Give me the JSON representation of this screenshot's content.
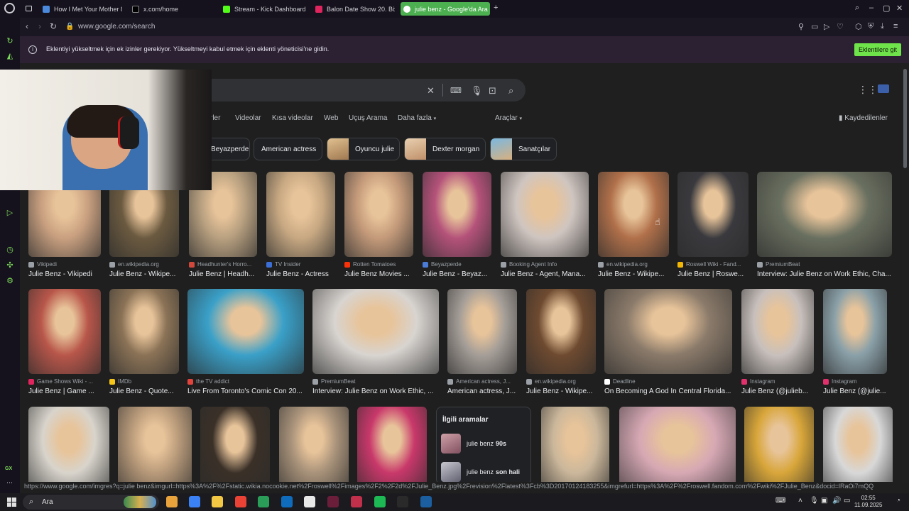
{
  "browser": {
    "tabs": [
      {
        "label": "How I Met Your Mother 8.",
        "color": "#4a89dc"
      },
      {
        "label": "x.com/home",
        "color": "#000000"
      },
      {
        "label": "Stream - Kick Dashboard",
        "color": "#53fc18"
      },
      {
        "label": "Balon Date Show 20. Böl",
        "color": "#e0245e"
      },
      {
        "label": "julie benz - Google'da Ara",
        "color": "#ffffff"
      }
    ],
    "new_tab": "+",
    "url": "www.google.com/search"
  },
  "notification": {
    "message": "Eklentiyi yükseltmek için ek izinler gerekiyor. Yükseltmeyi kabul etmek için eklenti yöneticisi'ne gidin.",
    "button": "Eklentilere git"
  },
  "search": {
    "filters": [
      "rler",
      "Videolar",
      "Kısa videolar",
      "Web",
      "Uçuş Arama",
      "Daha fazla",
      "Araçlar"
    ],
    "saved": "Kaydedilenler",
    "chips": [
      "Beyazperde",
      "American actress",
      "Oyuncu julie",
      "Dexter morgan",
      "Sanatçılar"
    ]
  },
  "row1": [
    {
      "source": "Vikipedi",
      "title": "Julie Benz - Vikipedi",
      "fav": "#9aa0a6",
      "c": "#c9a080"
    },
    {
      "source": "en.wikipedia.org",
      "title": "Julie Benz - Wikipe...",
      "fav": "#9aa0a6",
      "c": "#6b5a40"
    },
    {
      "source": "Headhunter's Horro...",
      "title": "Julie Benz | Headh...",
      "fav": "#d0483c",
      "c": "#b8a080"
    },
    {
      "source": "TV Insider",
      "title": "Julie Benz - Actress",
      "fav": "#3b6fd6",
      "c": "#c7a882"
    },
    {
      "source": "Rotten Tomatoes",
      "title": "Julie Benz Movies ...",
      "fav": "#fa320a",
      "c": "#c49a7a"
    },
    {
      "source": "Beyazperde",
      "title": "Julie Benz - Beyaz...",
      "fav": "#4a7bd6",
      "c": "#b4527a"
    },
    {
      "source": "Booking Agent Info",
      "title": "Julie Benz - Agent, Mana...",
      "fav": "#9aa0a6",
      "c": "#cfc5c0"
    },
    {
      "source": "en.wikipedia.org",
      "title": "Julie Benz - Wikipe...",
      "fav": "#9aa0a6",
      "c": "#b0704a"
    },
    {
      "source": "Roswell Wiki - Fand...",
      "title": "Julie Benz | Roswe...",
      "fav": "#f2b705",
      "c": "#3a3a3e"
    },
    {
      "source": "PremiumBeat",
      "title": "Interview: Julie Benz on Work Ethic, Cha...",
      "fav": "#9aa0a6",
      "c": "#6a7060"
    }
  ],
  "row2": [
    {
      "source": "Game Shows Wiki - ...",
      "title": "Julie Benz | Game ...",
      "fav": "#e0245e",
      "c": "#b8564a"
    },
    {
      "source": "IMDb",
      "title": "Julie Benz - Quote...",
      "fav": "#f5c518",
      "c": "#8a7256"
    },
    {
      "source": "the TV addict",
      "title": "Live From Toronto's Comic Con 20...",
      "fav": "#e0443c",
      "c": "#3aa0c8"
    },
    {
      "source": "PremiumBeat",
      "title": "Interview: Julie Benz on Work Ethic, ...",
      "fav": "#9aa0a6",
      "c": "#d8d4d0"
    },
    {
      "source": "American actress, J...",
      "title": "American actress, J...",
      "fav": "#9aa0a6",
      "c": "#a59e98"
    },
    {
      "source": "en.wikipedia.org",
      "title": "Julie Benz - Wikipe...",
      "fav": "#9aa0a6",
      "c": "#6e4a30"
    },
    {
      "source": "Deadline",
      "title": "On Becoming A God In Central Florida...",
      "fav": "#ffffff",
      "c": "#8a7a6a"
    },
    {
      "source": "Instagram",
      "title": "Julie Benz (@julieb...",
      "fav": "#e1306c",
      "c": "#c8c0bc"
    },
    {
      "source": "Instagram",
      "title": "Julie Benz (@julie...",
      "fav": "#e1306c",
      "c": "#8aa0a8"
    }
  ],
  "row3": [
    {
      "c": "#d8d4cc"
    },
    {
      "c": "#b89a7a"
    },
    {
      "c": "#3a3028"
    },
    {
      "c": "#a8927a"
    },
    {
      "c": "#c8386a"
    },
    {
      "c": "#cbb79b"
    },
    {
      "c": "#d6a8b4"
    },
    {
      "c": "#d8a63a"
    },
    {
      "c": "#d8d8d8"
    }
  ],
  "related": {
    "heading": "İlgili aramalar",
    "items": [
      {
        "prefix": "julie benz",
        "bold": "90s"
      },
      {
        "prefix": "julie benz",
        "bold": "son hali"
      }
    ]
  },
  "status_url": "https://www.google.com/imgres?q=julie benz&imgurl=https%3A%2F%2Fstatic.wikia.nocookie.net%2Froswell%2Fimages%2F2%2F2d%2FJulie_Benz.jpg%2Frevision%2Flatest%3Fcb%3D20170124183255&imgrefurl=https%3A%2F%2Froswell.fandom.com%2Fwiki%2FJulie_Benz&docid=lRaOi7mQQ",
  "taskbar": {
    "search": "Ara",
    "time": "02:55",
    "date": "11.09.2025",
    "icons": [
      "#e8a33d",
      "#3b82f6",
      "#f2c744",
      "#ea4335",
      "#2a9d58",
      "#0f6cbd",
      "#e8e8e8",
      "#6b1e3a",
      "#c0304a",
      "#1db954",
      "#2a2a2a",
      "#1b5fa0"
    ]
  },
  "sidebar_label": "GX"
}
